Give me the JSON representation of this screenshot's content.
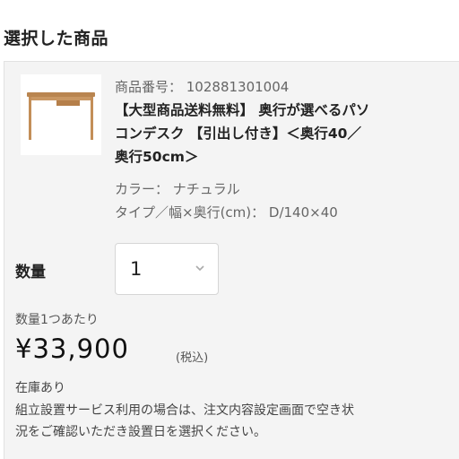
{
  "section": {
    "title": "選択した商品"
  },
  "product": {
    "number_label": "商品番号： 102881301004",
    "name_lines": [
      "【大型商品送料無料】 奥行が選べるパソ",
      "コンデスク 【引出し付き】＜奥行40／",
      "奥行50cm＞"
    ],
    "color_label": "カラー： ナチュラル",
    "type_label": "タイプ／幅×奥行(cm)： D/140×40",
    "image_icon": "desk-image"
  },
  "quantity": {
    "label": "数量",
    "value": "1",
    "icon": "chevron-down-icon"
  },
  "pricing": {
    "per_unit_label": "数量1つあたり",
    "price": "¥33,900",
    "tax_note": "(税込)"
  },
  "stock": {
    "status": "在庫あり"
  },
  "notice": {
    "lines": [
      "組立設置サービス利用の場合は、注文内容設定画面で空き状",
      "況をご確認いただき設置日を選択ください。"
    ]
  }
}
